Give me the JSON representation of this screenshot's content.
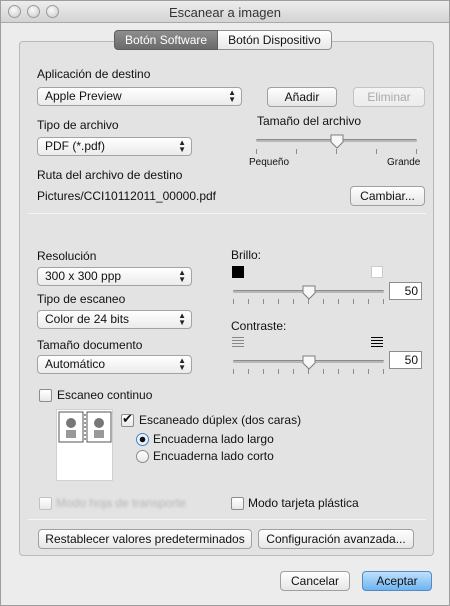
{
  "window": {
    "title": "Escanear a imagen"
  },
  "tabs": [
    {
      "label": "Botón Software",
      "active": true
    },
    {
      "label": "Botón Dispositivo",
      "active": false
    }
  ],
  "destination": {
    "label": "Aplicación de destino",
    "selected": "Apple Preview",
    "add_label": "Añadir",
    "remove_label": "Eliminar"
  },
  "file_type": {
    "label": "Tipo de archivo",
    "selected": "PDF (*.pdf)"
  },
  "file_size": {
    "label": "Tamaño del archivo",
    "min_label": "Pequeño",
    "max_label": "Grande",
    "level": 0.5
  },
  "path": {
    "label": "Ruta del archivo de destino",
    "value": "Pictures/CCI10112011_00000.pdf",
    "change_label": "Cambiar..."
  },
  "resolution": {
    "label": "Resolución",
    "selected": "300 x 300 ppp"
  },
  "scan_type": {
    "label": "Tipo de escaneo",
    "selected": "Color de 24 bits"
  },
  "doc_size": {
    "label": "Tamaño documento",
    "selected": "Automático"
  },
  "brightness": {
    "label": "Brillo:",
    "value": "50"
  },
  "contrast": {
    "label": "Contraste:",
    "value": "50"
  },
  "continuous": {
    "label": "Escaneo continuo",
    "checked": false
  },
  "duplex": {
    "label": "Escaneado dúplex (dos caras)",
    "checked": true,
    "long_edge": "Encuaderna lado largo",
    "short_edge": "Encuaderna lado corto",
    "selected": "long"
  },
  "carrier_mode": {
    "label": "Modo hoja de transporte",
    "checked": false,
    "disabled": true
  },
  "plastic_card": {
    "label": "Modo tarjeta plástica",
    "checked": false
  },
  "buttons": {
    "reset": "Restablecer valores predeterminados",
    "advanced": "Configuración avanzada...",
    "cancel": "Cancelar",
    "accept": "Aceptar"
  },
  "colors": {
    "accent": "#6fb4f0",
    "panel": "#e3e3e3"
  }
}
